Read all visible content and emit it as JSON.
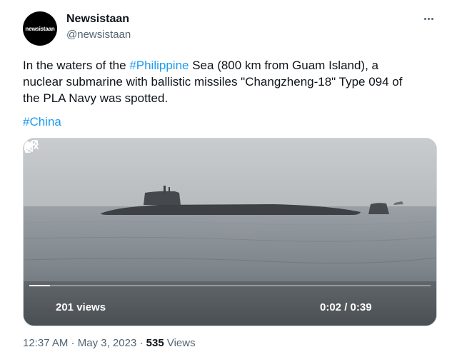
{
  "author": {
    "avatar_text": "newsistaan",
    "name": "Newsistaan",
    "handle": "@newsistaan"
  },
  "tweet": {
    "line1_pre": "In the waters of the ",
    "line1_link": "#Philippine",
    "line1_post": " Sea (800 km from Guam Island), a",
    "line2": "nuclear submarine with ballistic missiles \"Changzheng-18\" Type 094 of",
    "line3": "the PLA Navy was spotted.",
    "hashtag": "#China"
  },
  "video": {
    "views": "201 views",
    "time": "0:02 / 0:39",
    "progress_fraction": 0.0513
  },
  "footer": {
    "time": "12:37 AM",
    "sep1": " · ",
    "date": "May 3, 2023",
    "sep2": " · ",
    "view_count": "535",
    "views_label": " Views"
  },
  "colors": {
    "link": "#1d9bf0",
    "text": "#0f1419",
    "secondary": "#536471"
  },
  "icons": [
    "more-icon",
    "play-icon",
    "volume-icon",
    "fullscreen-icon"
  ]
}
